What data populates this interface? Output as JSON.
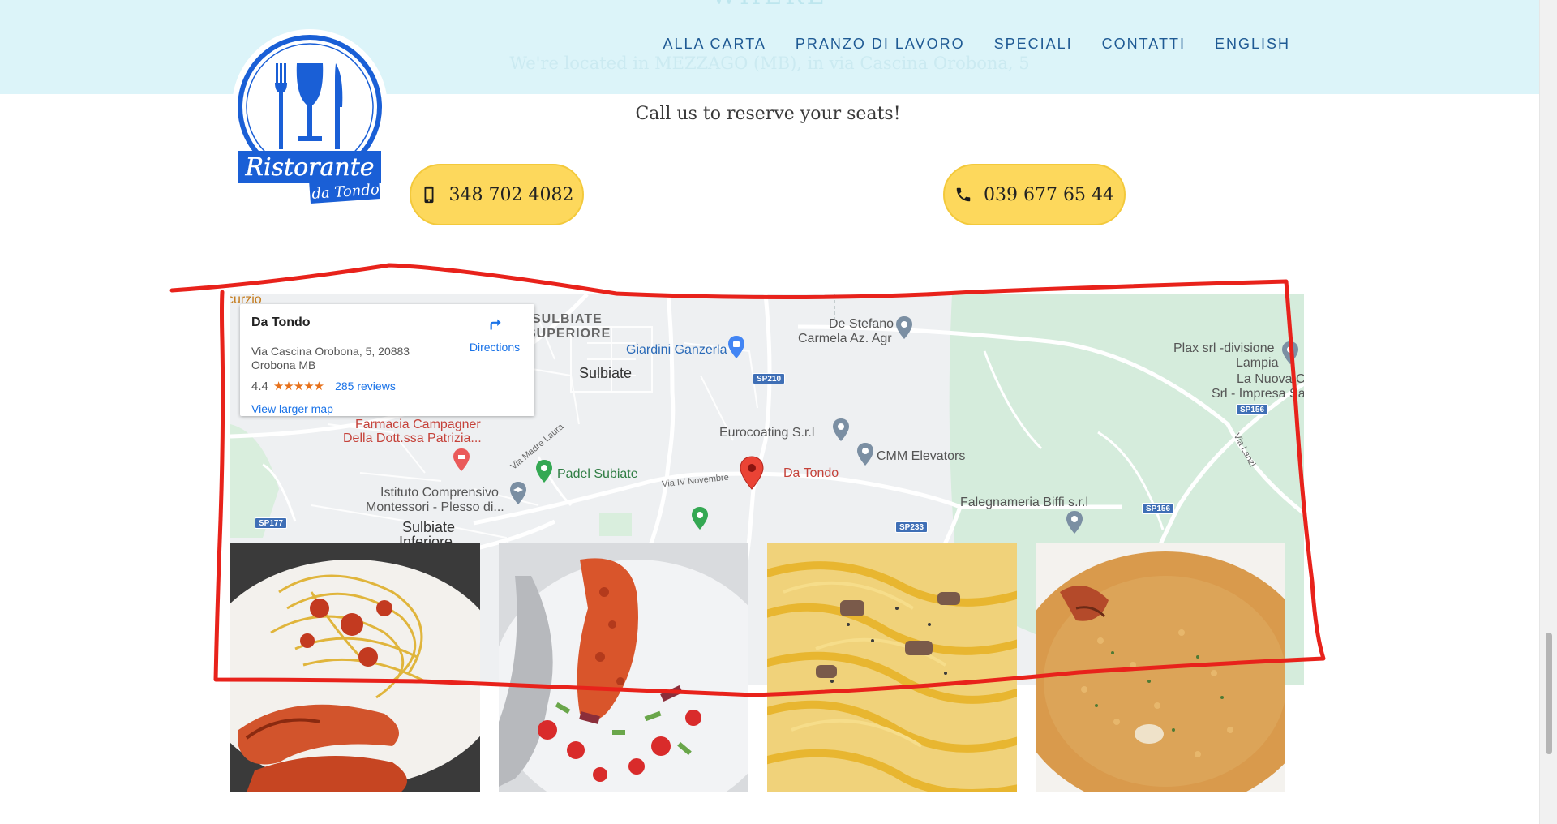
{
  "header": {
    "ghost_heading": "WHERE",
    "ghost_text": "We're located in MEZZAGO (MB), in via Cascina Orobona, 5",
    "nav": [
      "ALLA CARTA",
      "PRANZO DI LAVORO",
      "SPECIALI",
      "CONTATTI",
      "ENGLISH"
    ],
    "nav_color": "#1f5a94",
    "background": "#dcf4f9"
  },
  "logo": {
    "text_main": "Ristorante",
    "text_sub": "da Tondo",
    "color": "#1a5fd6"
  },
  "call": {
    "title": "Call us to reserve your seats!",
    "mobile": "348 702 4082",
    "landline": "039 677 65 44",
    "button_color": "#fdd85c"
  },
  "map": {
    "card": {
      "name": "Da Tondo",
      "address": "Via Cascina Orobona, 5, 20883 Orobona MB",
      "rating": "4.4",
      "stars": "★★★★★",
      "reviews": "285 reviews",
      "directions": "Directions",
      "view_larger": "View larger map"
    },
    "labels": {
      "sulbiate_superiore_1": "SULBIATE",
      "sulbiate_superiore_2": "SUPERIORE",
      "sulbiate": "Sulbiate",
      "giardini": "Giardini Ganzerla",
      "de_stefano_1": "De Stefano",
      "de_stefano_2": "Carmela Az. Agr",
      "plax_1": "Plax srl -divisione",
      "plax_2": "Lampia",
      "nuova_1": "La Nuova C",
      "nuova_2": "Srl - Impresa Sa",
      "farmacia_1": "Farmacia Campagner",
      "farmacia_2": "Della Dott.ssa Patrizia...",
      "eurocoating": "Eurocoating S.r.l",
      "cmm": "CMM Elevators",
      "padel": "Padel Subiate",
      "da_tondo": "Da Tondo",
      "istituto_1": "Istituto Comprensivo",
      "istituto_2": "Montessori - Plesso di...",
      "falegnameria": "Falegnameria Biffi s.r.l",
      "sulbiate_inferiore_1": "Sulbiate",
      "sulbiate_inferiore_2": "Inferiore",
      "curzio": "curzio",
      "via_madre_laura": "Via Madre Laura",
      "via_iv_novembre": "Via IV Novembre",
      "via_lanzi": "Via Lanzi",
      "sp210": "SP210",
      "sp156_a": "SP156",
      "sp156_b": "SP156",
      "sp177": "SP177",
      "sp233": "SP233"
    }
  },
  "photos": [
    {
      "alt": "spaghetti with lobster"
    },
    {
      "alt": "lobster with vegetables"
    },
    {
      "alt": "spaghetti carbonara"
    },
    {
      "alt": "seafood risotto"
    }
  ],
  "annotation_color": "#e8221b"
}
